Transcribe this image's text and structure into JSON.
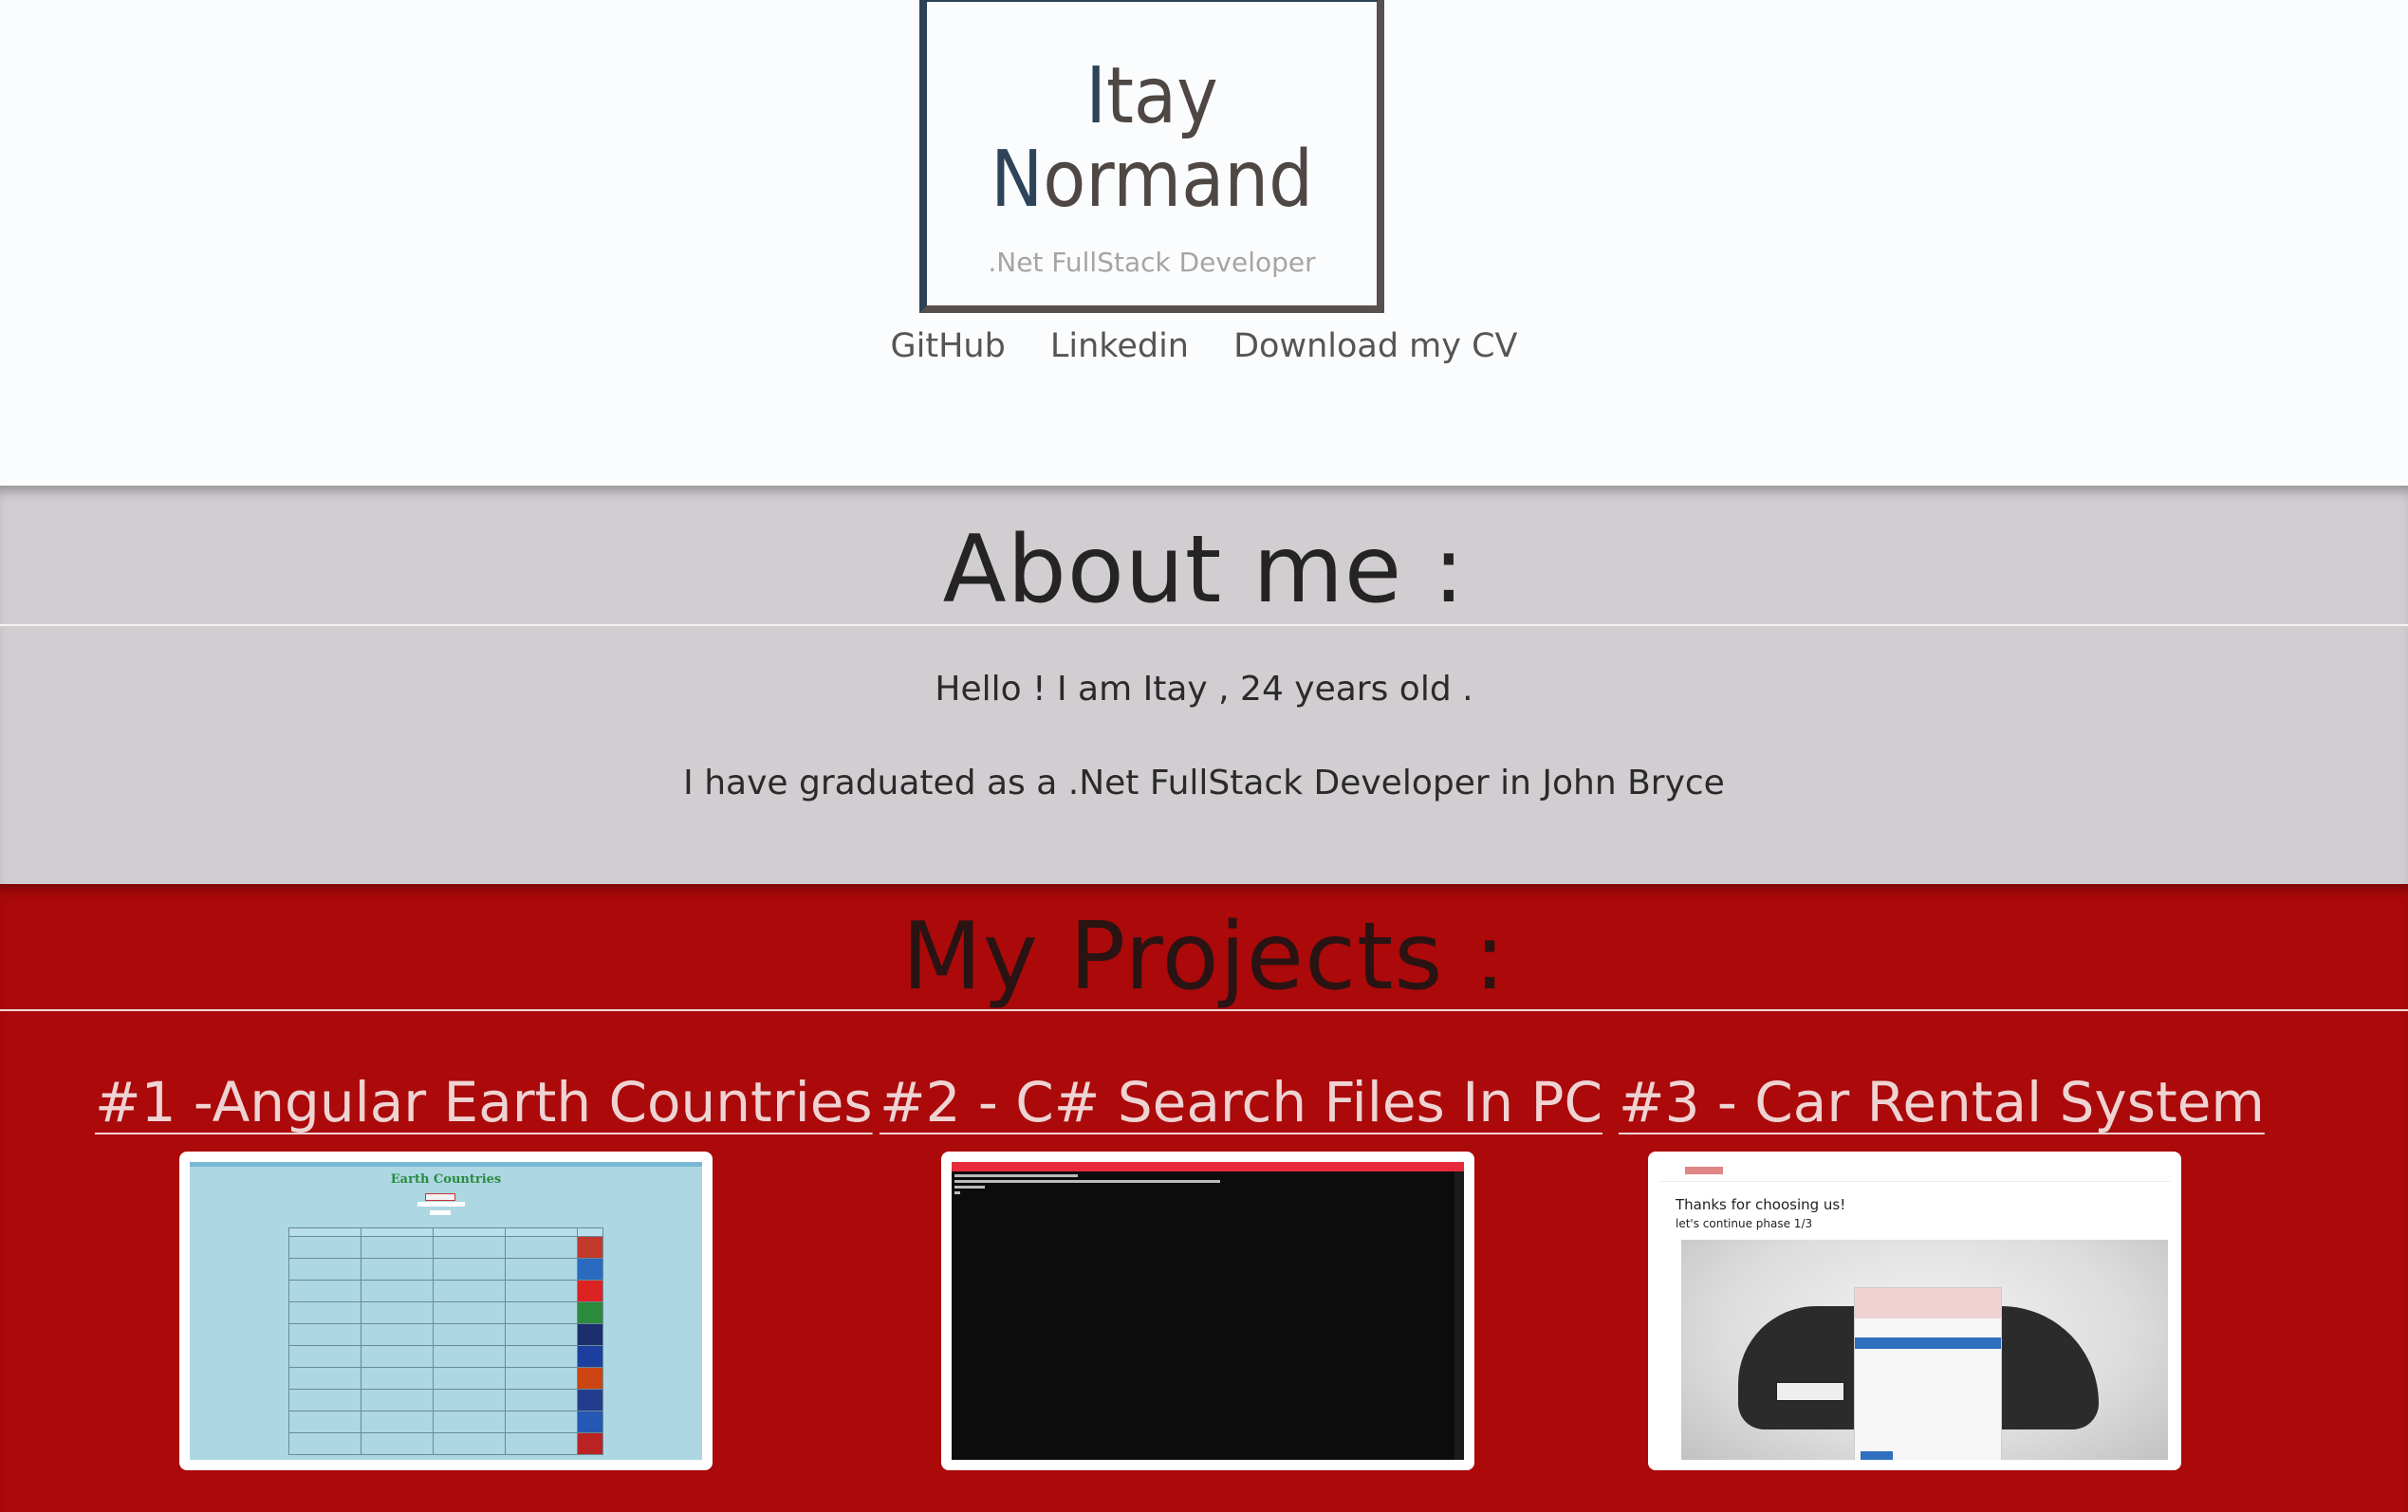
{
  "header": {
    "name_line1_first": "I",
    "name_line1_rest": "tay",
    "name_line2_first": "N",
    "name_line2_rest": "ormand",
    "subtitle": ".Net FullStack Developer",
    "links": [
      "GitHub",
      "Linkedin",
      "Download my CV"
    ]
  },
  "about": {
    "title": "About me :",
    "paragraphs": [
      "Hello ! I am Itay , 24 years old .",
      "I have graduated as a .Net FullStack Developer in John Bryce"
    ]
  },
  "projects": {
    "title": "My Projects :",
    "items": [
      {
        "title": "#1 -Angular Earth Countries",
        "screenshot_title": "Earth Countries"
      },
      {
        "title": "#2 - C# Search Files In PC"
      },
      {
        "title": "#3 - Car Rental System",
        "screenshot_lines": [
          "Thanks for choosing us!",
          "let's continue phase 1/3"
        ]
      }
    ]
  },
  "colors": {
    "background": "#fbfcfe",
    "about_background": "#d1cdd1",
    "projects_background": "#ab090a",
    "logo_accent": "#2e4459"
  }
}
